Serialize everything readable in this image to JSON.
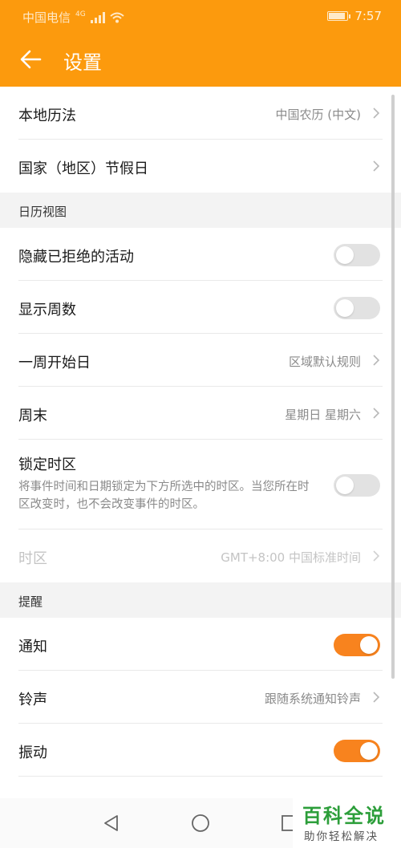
{
  "status_bar": {
    "carrier": "中国电信",
    "network": "4G",
    "time": "7:57"
  },
  "header": {
    "title": "设置"
  },
  "rows_general": [
    {
      "label": "本地历法",
      "value": "中国农历 (中文)"
    },
    {
      "label": "国家（地区）节假日",
      "value": ""
    }
  ],
  "section_calendar_view": {
    "title": "日历视图"
  },
  "calendar_view": {
    "hide_declined": {
      "label": "隐藏已拒绝的活动",
      "on": false
    },
    "show_week_numbers": {
      "label": "显示周数",
      "on": false
    },
    "week_start": {
      "label": "一周开始日",
      "value": "区域默认规则"
    },
    "weekend": {
      "label": "周末",
      "value": "星期日 星期六"
    },
    "lock_timezone": {
      "label": "锁定时区",
      "description": "将事件时间和日期锁定为下方所选中的时区。当您所在时区改变时，也不会改变事件的时区。",
      "on": false
    },
    "timezone": {
      "label": "时区",
      "value": "GMT+8:00 中国标准时间"
    }
  },
  "section_reminder": {
    "title": "提醒"
  },
  "reminder": {
    "notification": {
      "label": "通知",
      "on": true
    },
    "ringtone": {
      "label": "铃声",
      "value": "跟随系统通知铃声"
    },
    "vibration": {
      "label": "振动",
      "on": true
    }
  },
  "watermark": {
    "brand": "百科全说",
    "slogan": "助你轻松解决"
  },
  "colors": {
    "accent": "#fc9a0d",
    "toggle_on": "#f8831e",
    "toggle_off": "#e2e2e2"
  }
}
